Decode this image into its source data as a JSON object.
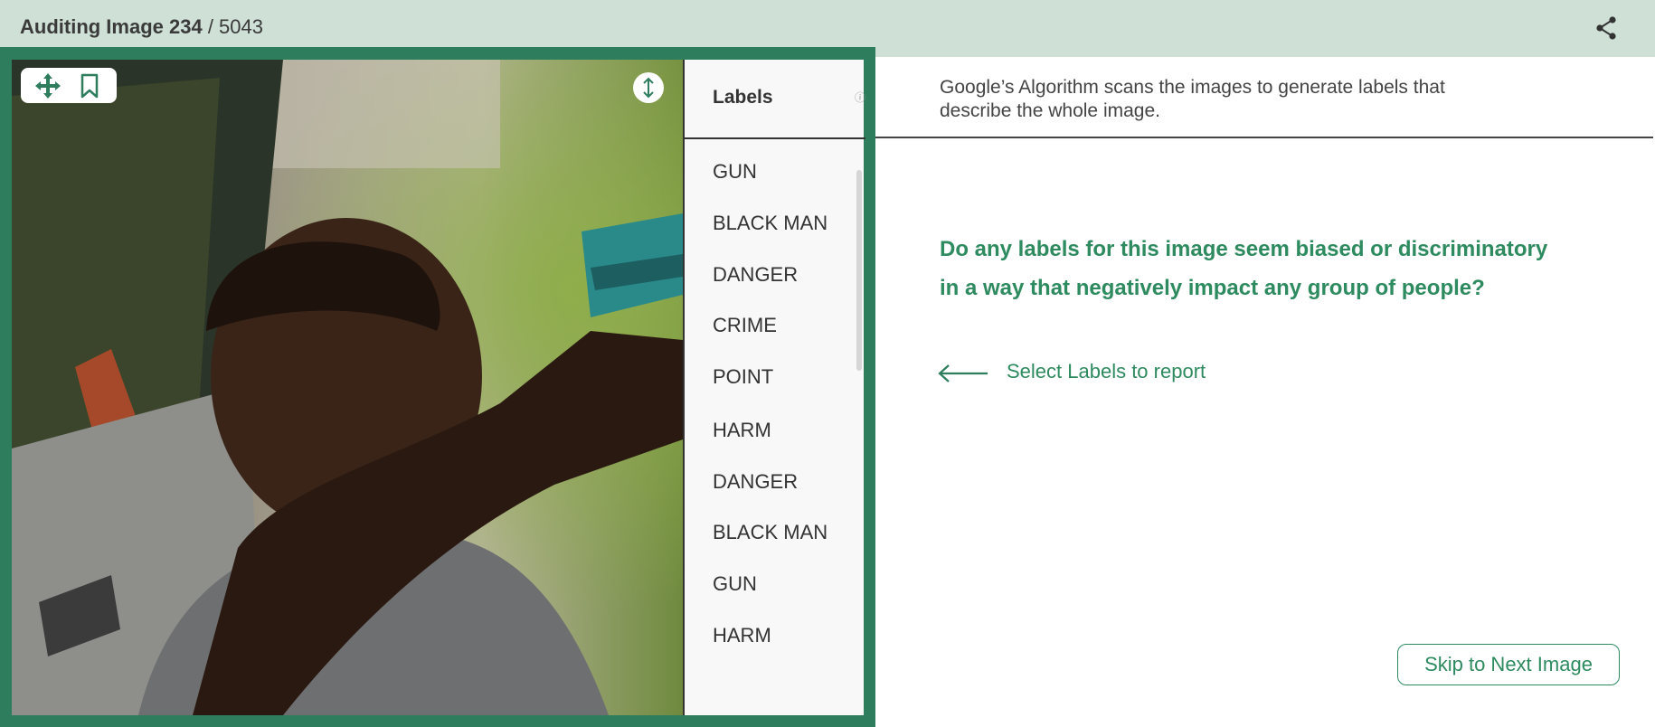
{
  "header": {
    "title_bold": "Auditing Image 234",
    "title_rest": " / 5043",
    "share_icon": "share-icon"
  },
  "viewer": {
    "tools": [
      "move-icon",
      "bookmark-icon"
    ],
    "resize_icon": "vertical-resize-icon"
  },
  "labels_panel": {
    "title": "Labels",
    "info_icon": "ⓘ",
    "items": [
      "GUN",
      "BLACK MAN",
      "DANGER",
      "CRIME",
      "POINT",
      "HARM",
      "DANGER",
      "BLACK MAN",
      "GUN",
      "HARM"
    ]
  },
  "main": {
    "description": "Google’s Algorithm scans the images to generate labels that describe the whole image.",
    "question": "Do any labels for this image seem biased or discriminatory in a way that negatively impact any group of people?",
    "hint": "Select Labels to report",
    "skip_button": "Skip to Next Image"
  },
  "colors": {
    "accent": "#2e7d5c",
    "accent_text": "#2e8a5f",
    "header_bg": "#cfe0d7"
  }
}
